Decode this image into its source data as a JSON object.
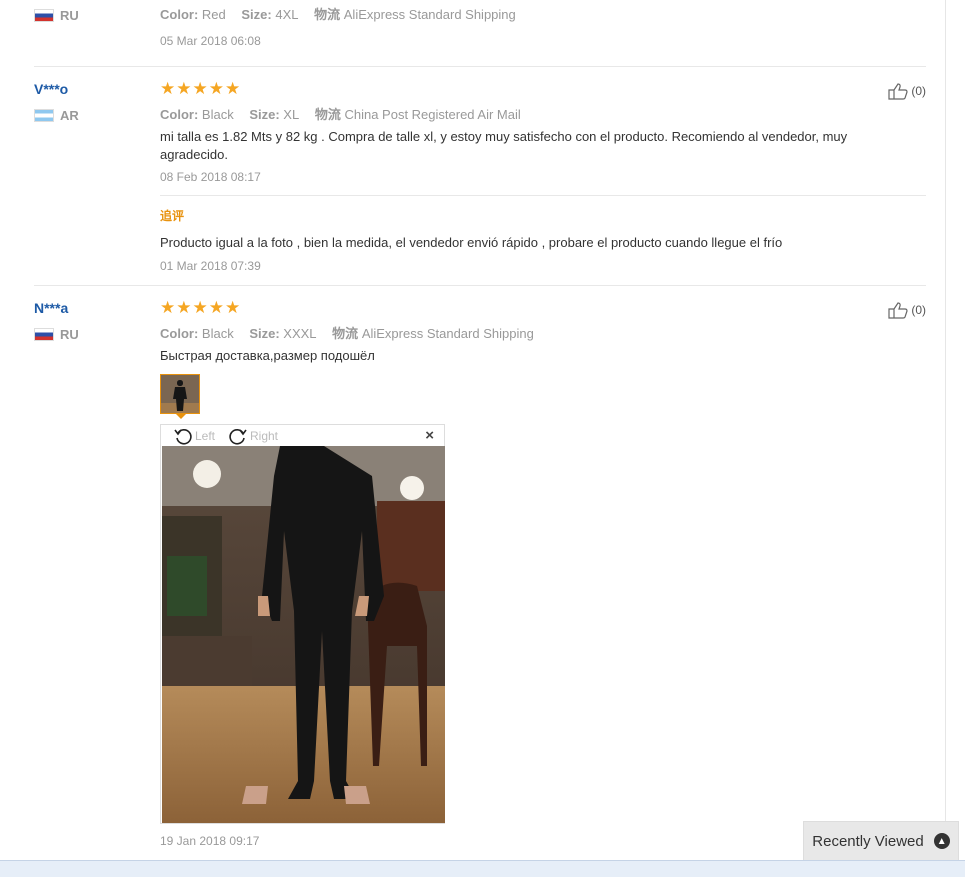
{
  "reviews": [
    {
      "country": "RU",
      "color_label": "Color:",
      "color": "Red",
      "size_label": "Size:",
      "size": "4XL",
      "shipping_label": "物流",
      "shipping": "AliExpress Standard Shipping",
      "date": "05 Mar 2018 06:08"
    },
    {
      "user": "V***o",
      "country": "AR",
      "rating": 5,
      "color_label": "Color:",
      "color": "Black",
      "size_label": "Size:",
      "size": "XL",
      "shipping_label": "物流",
      "shipping": "China Post Registered Air Mail",
      "text": "mi talla es 1.82 Mts y 82 kg . Compra de talle xl, y estoy muy satisfecho con el producto. Recomiendo al vendedor, muy agradecido.",
      "date": "08 Feb 2018 08:17",
      "helpful": "(0)",
      "followup_label": "追评",
      "followup_text": "Producto igual a la foto , bien la medida, el vendedor envió rápido , probare el producto cuando llegue el frío",
      "followup_date": "01 Mar 2018 07:39"
    },
    {
      "user": "N***a",
      "country": "RU",
      "rating": 5,
      "color_label": "Color:",
      "color": "Black",
      "size_label": "Size:",
      "size": "XXXL",
      "shipping_label": "物流",
      "shipping": "AliExpress Standard Shipping",
      "text": "Быстрая доставка,размер подошёл",
      "date": "19 Jan 2018 09:17",
      "helpful": "(0)"
    }
  ],
  "viewer": {
    "rotate_left": "Left",
    "rotate_right": "Right",
    "close": "×"
  },
  "recently_viewed": "Recently Viewed",
  "colors": {
    "star": "#f5a623",
    "user_link": "#1d5aa6",
    "accent": "#e8920e"
  }
}
